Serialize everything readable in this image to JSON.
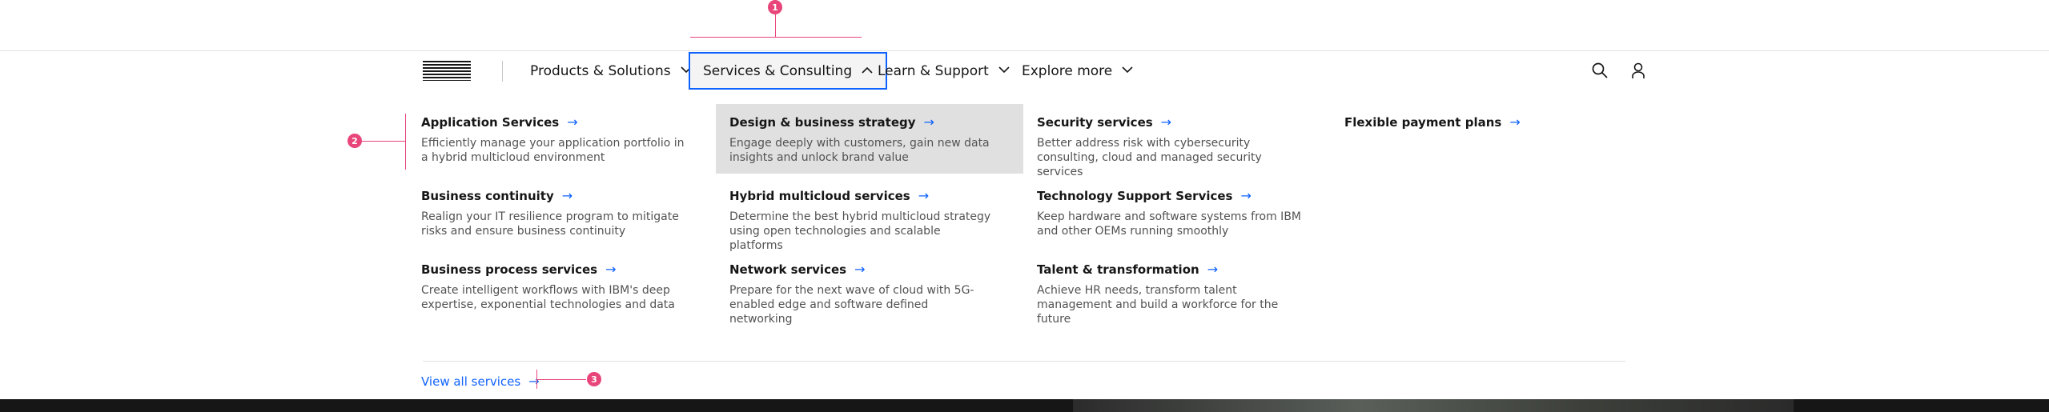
{
  "nav": {
    "logo_text": "IBM",
    "items": [
      {
        "label": "Products & Solutions"
      },
      {
        "label": "Services & Consulting"
      },
      {
        "label": "Learn & Support"
      },
      {
        "label": "Explore more"
      }
    ],
    "icons": {
      "search": "search-icon",
      "user": "user-icon",
      "chevron_down": "chevron-down-icon",
      "chevron_up": "chevron-up-icon"
    }
  },
  "menu": {
    "columns": [
      [
        {
          "title": "Application Services",
          "desc": "Efficiently manage your application portfolio in a hybrid multicloud environment"
        },
        {
          "title": "Business continuity",
          "desc": "Realign your IT resilience program to mitigate risks and ensure business continuity"
        },
        {
          "title": "Business process services",
          "desc": "Create intelligent workflows with IBM's deep expertise, exponential technologies and data"
        }
      ],
      [
        {
          "title": "Design & business strategy",
          "desc": "Engage deeply with customers, gain new data insights and unlock brand value"
        },
        {
          "title": "Hybrid multicloud services",
          "desc": "Determine the best hybrid multicloud strategy using open technologies and scalable platforms"
        },
        {
          "title": "Network services",
          "desc": "Prepare for the next wave of cloud with 5G-enabled edge and software defined networking"
        }
      ],
      [
        {
          "title": "Security services",
          "desc": "Better address risk with cybersecurity consulting, cloud and managed security services"
        },
        {
          "title": "Technology Support Services",
          "desc": "Keep hardware and software systems from IBM and other OEMs running smoothly"
        },
        {
          "title": "Talent & transformation",
          "desc": "Achieve HR needs, transform talent management and build a workforce for the future"
        }
      ],
      [
        {
          "title": "Flexible payment plans"
        }
      ]
    ],
    "view_all": "View all services"
  },
  "annotations": [
    "1",
    "2",
    "3"
  ],
  "colors": {
    "accent": "#0f62fe",
    "annotation": "#e8457a",
    "highlight": "#e0e0e0"
  }
}
